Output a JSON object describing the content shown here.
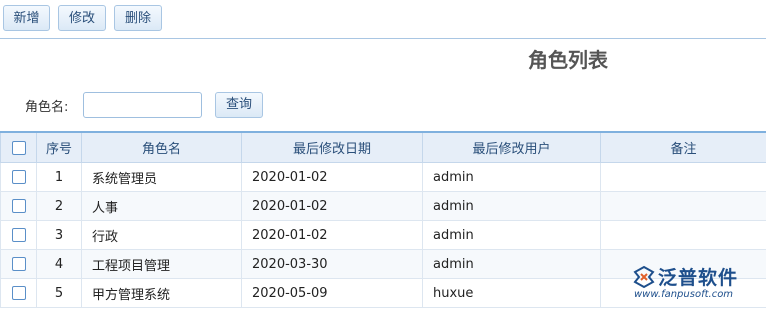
{
  "toolbar": {
    "add_label": "新增",
    "edit_label": "修改",
    "delete_label": "删除"
  },
  "page": {
    "title": "角色列表"
  },
  "search": {
    "label": "角色名:",
    "value": "",
    "placeholder": "",
    "button_label": "查询"
  },
  "table": {
    "headers": {
      "index": "序号",
      "role_name": "角色名",
      "modified_date": "最后修改日期",
      "modified_user": "最后修改用户",
      "remark": "备注"
    },
    "rows": [
      {
        "index": "1",
        "role_name": "系统管理员",
        "modified_date": "2020-01-02",
        "modified_user": "admin",
        "remark": "",
        "checked": false
      },
      {
        "index": "2",
        "role_name": "人事",
        "modified_date": "2020-01-02",
        "modified_user": "admin",
        "remark": "",
        "checked": false
      },
      {
        "index": "3",
        "role_name": "行政",
        "modified_date": "2020-01-02",
        "modified_user": "admin",
        "remark": "",
        "checked": false
      },
      {
        "index": "4",
        "role_name": "工程项目管理",
        "modified_date": "2020-03-30",
        "modified_user": "admin",
        "remark": "",
        "checked": false
      },
      {
        "index": "5",
        "role_name": "甲方管理系统",
        "modified_date": "2020-05-09",
        "modified_user": "huxue",
        "remark": "",
        "checked": false
      }
    ]
  },
  "watermark": {
    "brand": "泛普软件",
    "url": "www.fanpusoft.com"
  },
  "colors": {
    "accent": "#2a4f7a",
    "header_bg": "#e6eef8",
    "border": "#a9c6e3",
    "brand": "#1e4f8c"
  }
}
